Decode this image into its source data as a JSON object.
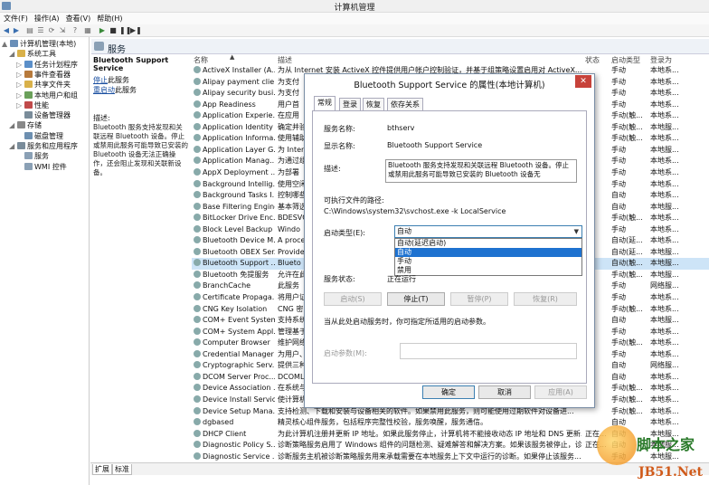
{
  "window": {
    "title": "计算机管理"
  },
  "menu": [
    "文件(F)",
    "操作(A)",
    "查看(V)",
    "帮助(H)"
  ],
  "tree": [
    {
      "label": "计算机管理(本地)",
      "level": 0,
      "color": "#6a8fb8",
      "exp": "▲"
    },
    {
      "label": "系统工具",
      "level": 1,
      "color": "#d9b14a",
      "exp": "◢"
    },
    {
      "label": "任务计划程序",
      "level": 2,
      "color": "#5b8fc9",
      "exp": "▷"
    },
    {
      "label": "事件查看器",
      "level": 2,
      "color": "#b77a3c",
      "exp": "▷"
    },
    {
      "label": "共享文件夹",
      "level": 2,
      "color": "#d9b14a",
      "exp": "▷"
    },
    {
      "label": "本地用户和组",
      "level": 2,
      "color": "#6aa05a",
      "exp": "▷"
    },
    {
      "label": "性能",
      "level": 2,
      "color": "#c04a4a",
      "exp": "▷"
    },
    {
      "label": "设备管理器",
      "level": 2,
      "color": "#7a8c9a",
      "exp": ""
    },
    {
      "label": "存储",
      "level": 1,
      "color": "#888",
      "exp": "◢"
    },
    {
      "label": "磁盘管理",
      "level": 2,
      "color": "#6d8fb0",
      "exp": ""
    },
    {
      "label": "服务和应用程序",
      "level": 1,
      "color": "#7a8c9a",
      "exp": "◢"
    },
    {
      "label": "服务",
      "level": 2,
      "color": "#8aa0b5",
      "exp": ""
    },
    {
      "label": "WMI 控件",
      "level": 2,
      "color": "#8aa0b5",
      "exp": ""
    }
  ],
  "services_header": "服务",
  "detail": {
    "name": "Bluetooth Support Service",
    "stop_link": "停止",
    "stop_suffix": "此服务",
    "restart_link": "重启动",
    "restart_suffix": "此服务",
    "desc_label": "描述:",
    "desc": "Bluetooth 服务支持发现和关联远程 Bluetooth 设备。停止或禁用此服务可能导致已安装的 Bluetooth 设备无法正确操作，还会阻止发现和关联新设备。"
  },
  "columns": {
    "name": "名称",
    "desc": "描述",
    "status": "状态",
    "startup": "启动类型",
    "logon": "登录为"
  },
  "rows": [
    {
      "name": "ActiveX Installer (A...",
      "desc": "为从 Internet 安装 ActiveX 控件提供用户帐户控制验证，并基于组策略设置启用对 ActiveX...",
      "status": "",
      "startup": "手动",
      "logon": "本地系..."
    },
    {
      "name": "Alipay payment clie...",
      "desc": "为支付",
      "status": "",
      "startup": "手动",
      "logon": "本地系..."
    },
    {
      "name": "Alipay security busi...",
      "desc": "为支付",
      "status": "",
      "startup": "手动",
      "logon": "本地系..."
    },
    {
      "name": "App Readiness",
      "desc": "用户首",
      "status": "",
      "startup": "手动",
      "logon": "本地系..."
    },
    {
      "name": "Application Experie...",
      "desc": "在应用",
      "status": "",
      "startup": "手动(触...",
      "logon": "本地系..."
    },
    {
      "name": "Application Identity",
      "desc": "确定并验",
      "status": "",
      "startup": "手动(触...",
      "logon": "本地服..."
    },
    {
      "name": "Application Informa...",
      "desc": "使用辅助",
      "status": "",
      "startup": "手动(触...",
      "logon": "本地系..."
    },
    {
      "name": "Application Layer G...",
      "desc": "为 Inter",
      "status": "",
      "startup": "手动",
      "logon": "本地服..."
    },
    {
      "name": "Application Manag...",
      "desc": "为通过组",
      "status": "",
      "startup": "手动",
      "logon": "本地系..."
    },
    {
      "name": "AppX Deployment ...",
      "desc": "为部署",
      "status": "",
      "startup": "手动",
      "logon": "本地系..."
    },
    {
      "name": "Background Intellig...",
      "desc": "使用空闲",
      "status": "",
      "startup": "手动",
      "logon": "本地系..."
    },
    {
      "name": "Background Tasks I...",
      "desc": "控制哪些",
      "status": "",
      "startup": "自动",
      "logon": "本地系..."
    },
    {
      "name": "Base Filtering Engine",
      "desc": "基本筛选",
      "status": "",
      "startup": "自动",
      "logon": "本地服..."
    },
    {
      "name": "BitLocker Drive Enc...",
      "desc": "BDESVC",
      "status": "",
      "startup": "手动(触...",
      "logon": "本地系..."
    },
    {
      "name": "Block Level Backup ...",
      "desc": "Windo",
      "status": "",
      "startup": "手动",
      "logon": "本地系..."
    },
    {
      "name": "Bluetooth Device M...",
      "desc": "A proce",
      "status": "",
      "startup": "自动(延...",
      "logon": "本地系..."
    },
    {
      "name": "Bluetooth OBEX Ser...",
      "desc": "Provide",
      "status": "",
      "startup": "自动(延...",
      "logon": "本地服..."
    },
    {
      "name": "Bluetooth Support ...",
      "desc": "Blueto",
      "status": "",
      "startup": "自动(触...",
      "logon": "本地服..."
    },
    {
      "name": "Bluetooth 免提服务",
      "desc": "允许在此",
      "status": "",
      "startup": "手动(触...",
      "logon": "本地服..."
    },
    {
      "name": "BranchCache",
      "desc": "此服务",
      "status": "",
      "startup": "手动",
      "logon": "网络服..."
    },
    {
      "name": "Certificate Propaga...",
      "desc": "将用户证",
      "status": "",
      "startup": "手动",
      "logon": "本地系..."
    },
    {
      "name": "CNG Key Isolation",
      "desc": "CNG 密",
      "status": "",
      "startup": "手动(触...",
      "logon": "本地系..."
    },
    {
      "name": "COM+ Event System",
      "desc": "支持系统",
      "status": "",
      "startup": "自动",
      "logon": "本地服..."
    },
    {
      "name": "COM+ System Appl...",
      "desc": "管理基于",
      "status": "",
      "startup": "手动",
      "logon": "本地系..."
    },
    {
      "name": "Computer Browser",
      "desc": "维护网络",
      "status": "",
      "startup": "手动(触...",
      "logon": "本地系..."
    },
    {
      "name": "Credential Manager",
      "desc": "为用户、",
      "status": "",
      "startup": "手动",
      "logon": "本地系..."
    },
    {
      "name": "Cryptographic Serv...",
      "desc": "提供三种",
      "status": "",
      "startup": "自动",
      "logon": "网络服..."
    },
    {
      "name": "DCOM Server Proc...",
      "desc": "DCOML",
      "status": "",
      "startup": "自动",
      "logon": "本地系..."
    },
    {
      "name": "Device Association ...",
      "desc": "在系统与",
      "status": "",
      "startup": "手动(触...",
      "logon": "本地系..."
    },
    {
      "name": "Device Install Service",
      "desc": "使计算机",
      "status": "",
      "startup": "手动(触...",
      "logon": "本地系..."
    },
    {
      "name": "Device Setup Mana...",
      "desc": "支持检测、下载和安装与设备相关的软件。如果禁用此服务，则可能使用过期软件对设备进...",
      "status": "",
      "startup": "手动(触...",
      "logon": "本地系..."
    },
    {
      "name": "dgbased",
      "desc": "精灵核心组件服务，包括程序完整性校验，服务唤醒，服务通信。",
      "status": "",
      "startup": "自动",
      "logon": "本地系..."
    },
    {
      "name": "DHCP Client",
      "desc": "为此计算机注册并更新 IP 地址。如果此服务停止，计算机将不能接收动态 IP 地址和 DNS 更新...",
      "status": "正在...",
      "startup": "自动",
      "logon": "本地服..."
    },
    {
      "name": "Diagnostic Policy S...",
      "desc": "诊断策略服务启用了 Windows 组件的问题检测、疑难解答和解决方案。如果该服务被停止，诊...",
      "status": "正在...",
      "startup": "自动",
      "logon": "本地服..."
    },
    {
      "name": "Diagnostic Service ...",
      "desc": "诊断服务主机被诊断策略服务用来承载需要在本地服务上下文中运行的诊断。如果停止该服务...",
      "status": "",
      "startup": "手动",
      "logon": "本地服..."
    }
  ],
  "bottom_tabs": [
    "扩展",
    "标准"
  ],
  "dialog": {
    "title": "Bluetooth Support Service 的属性(本地计算机)",
    "tabs": [
      "常规",
      "登录",
      "恢复",
      "依存关系"
    ],
    "service_name_label": "服务名称:",
    "service_name": "bthserv",
    "display_name_label": "显示名称:",
    "display_name": "Bluetooth Support Service",
    "desc_label": "描述:",
    "desc": "Bluetooth 服务支持发现和关联远程 Bluetooth 设备。停止或禁用此服务可能导致已安装的 Bluetooth 设备无",
    "exe_label": "可执行文件的路径:",
    "exe": "C:\\Windows\\system32\\svchost.exe -k LocalService",
    "startup_label": "启动类型(E):",
    "startup_value": "自动",
    "startup_options": [
      "自动(延迟启动)",
      "自动",
      "手动",
      "禁用"
    ],
    "startup_highlighted": 1,
    "status_label": "服务状态:",
    "status_value": "正在运行",
    "btn_start": "启动(S)",
    "btn_stop": "停止(T)",
    "btn_pause": "暂停(P)",
    "btn_resume": "恢复(R)",
    "params_hint": "当从此处启动服务时，你可指定所适用的启动参数。",
    "params_label": "启动参数(M):",
    "ok": "确定",
    "cancel": "取消",
    "apply": "应用(A)"
  },
  "watermark": {
    "line1": "脚本之家",
    "line2": "JB51.Net"
  }
}
